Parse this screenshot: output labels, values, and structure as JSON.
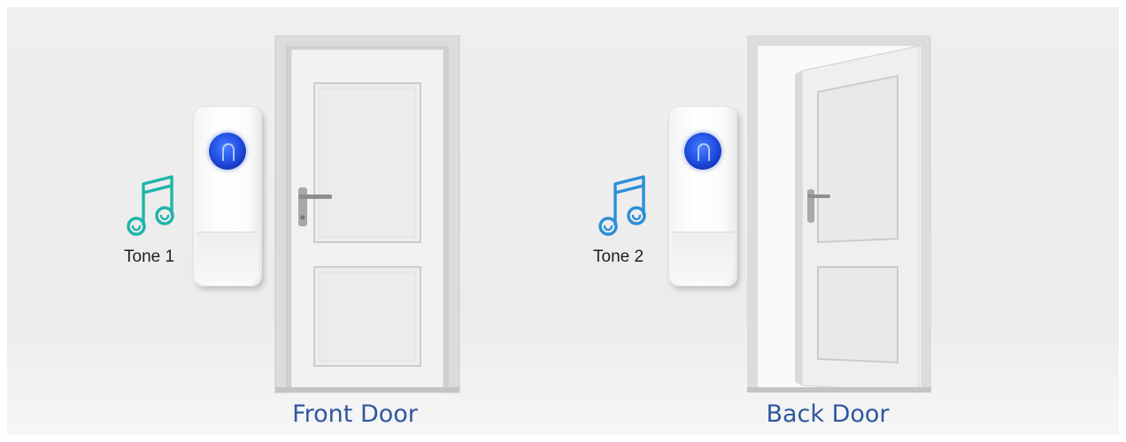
{
  "scenes": [
    {
      "tone_label": "Tone 1",
      "door_label": "Front Door",
      "door_state": "closed",
      "note_icon": "music-note-icon",
      "note_color": "#1fb5a8"
    },
    {
      "tone_label": "Tone 2",
      "door_label": "Back Door",
      "door_state": "open",
      "note_icon": "music-note-icon",
      "note_color": "#2b8fd8"
    }
  ],
  "colors": {
    "label_blue": "#2e57a0",
    "bell_button_blue": "#2352e6"
  }
}
